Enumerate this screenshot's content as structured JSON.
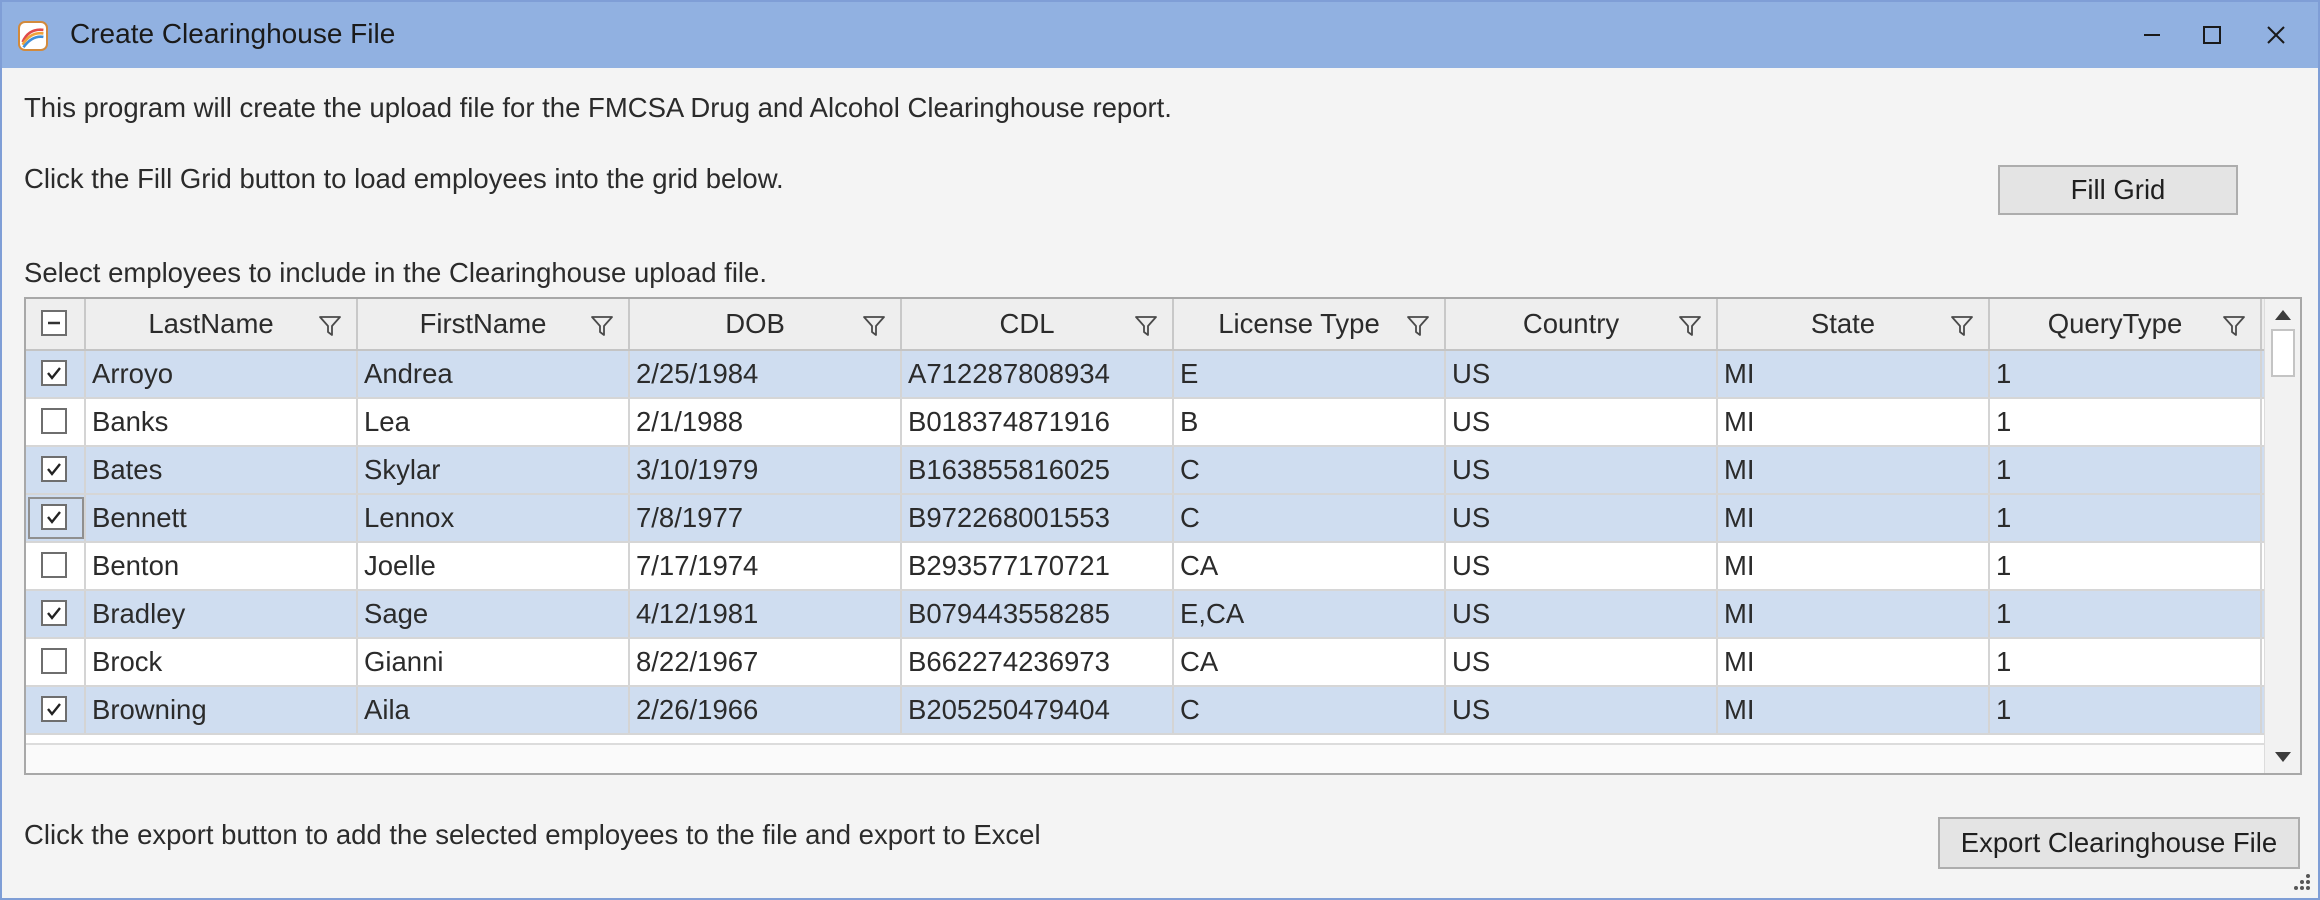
{
  "window": {
    "title": "Create Clearinghouse File",
    "controls": [
      "minimize-icon",
      "maximize-icon",
      "close-icon"
    ]
  },
  "labels": {
    "intro": "This program will create the upload file for the FMCSA Drug and Alcohol Clearinghouse report.",
    "fill_instruction": "Click the Fill Grid button to load employees into the grid below.",
    "select_instruction": "Select employees to include in the Clearinghouse upload file.",
    "export_instruction": "Click the export button to add the selected employees to the file and export to Excel"
  },
  "buttons": {
    "fill_grid": "Fill Grid",
    "export": "Export Clearinghouse File"
  },
  "grid": {
    "header_checkbox": "indeterminate",
    "columns": [
      "LastName",
      "FirstName",
      "DOB",
      "CDL",
      "License Type",
      "Country",
      "State",
      "QueryType"
    ],
    "rows": [
      {
        "checked": true,
        "cells": [
          "Arroyo",
          "Andrea",
          "2/25/1984",
          "A712287808934",
          "E",
          "US",
          "MI",
          "1"
        ]
      },
      {
        "checked": false,
        "cells": [
          "Banks",
          "Lea",
          "2/1/1988",
          "B018374871916",
          "B",
          "US",
          "MI",
          "1"
        ]
      },
      {
        "checked": true,
        "cells": [
          "Bates",
          "Skylar",
          "3/10/1979",
          "B163855816025",
          "C",
          "US",
          "MI",
          "1"
        ]
      },
      {
        "checked": true,
        "cells": [
          "Bennett",
          "Lennox",
          "7/8/1977",
          "B972268001553",
          "C",
          "US",
          "MI",
          "1"
        ]
      },
      {
        "checked": false,
        "cells": [
          "Benton",
          "Joelle",
          "7/17/1974",
          "B293577170721",
          "CA",
          "US",
          "MI",
          "1"
        ]
      },
      {
        "checked": true,
        "cells": [
          "Bradley",
          "Sage",
          "4/12/1981",
          "B079443558285",
          "E,CA",
          "US",
          "MI",
          "1"
        ]
      },
      {
        "checked": false,
        "cells": [
          "Brock",
          "Gianni",
          "8/22/1967",
          "B662274236973",
          "CA",
          "US",
          "MI",
          "1"
        ]
      },
      {
        "checked": true,
        "cells": [
          "Browning",
          "Aila",
          "2/26/1966",
          "B205250479404",
          "C",
          "US",
          "MI",
          "1"
        ]
      }
    ]
  },
  "colors": {
    "titlebar": "#91b1e1",
    "selected_row": "#cfddf0",
    "window_bg": "#f4f4f4"
  }
}
